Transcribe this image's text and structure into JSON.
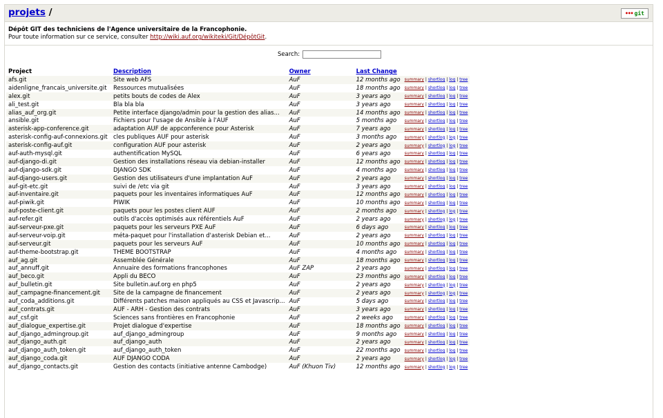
{
  "header": {
    "breadcrumb_link": "projets",
    "breadcrumb_sep": "/",
    "logo_dots": "•••",
    "logo_text": "git"
  },
  "description": {
    "line1": "Dépôt GIT des techniciens de l'Agence universitaire de la Francophonie.",
    "line2_prefix": "Pour toute information sur ce service, consulter ",
    "line2_link": "http://wiki.auf.org/wikiteki/Git/DépôtGit",
    "line2_suffix": "."
  },
  "search": {
    "label": "Search:",
    "value": ""
  },
  "table": {
    "headers": {
      "project": "Project",
      "description": "Description",
      "owner": "Owner",
      "last_change": "Last Change"
    },
    "links": {
      "summary": "summary",
      "shortlog": "shortlog",
      "log": "log",
      "tree": "tree",
      "sep": "|"
    },
    "rows": [
      {
        "project": "afs.git",
        "description": "Site web AFS",
        "owner": "AuF",
        "age": "12 months ago"
      },
      {
        "project": "aidenligne_francais_universite.git",
        "description": "Ressources mutualisées",
        "owner": "AuF",
        "age": "18 months ago"
      },
      {
        "project": "alex.git",
        "description": "petits bouts de codes de Alex",
        "owner": "AuF",
        "age": "3 years ago"
      },
      {
        "project": "ali_test.git",
        "description": "Bla bla bla",
        "owner": "AuF",
        "age": "3 years ago"
      },
      {
        "project": "alias_auf_org.git",
        "description": "Petite interface django/admin pour la gestion des alias...",
        "owner": "AuF",
        "age": "14 months ago"
      },
      {
        "project": "ansible.git",
        "description": "Fichiers pour l'usage de Ansible à l'AUF",
        "owner": "AuF",
        "age": "5 months ago"
      },
      {
        "project": "asterisk-app-conference.git",
        "description": "adaptation AUF de appconference pour Asterisk",
        "owner": "AuF",
        "age": "7 years ago"
      },
      {
        "project": "asterisk-config-auf-connexions.git",
        "description": "cles publiques AUF pour asterisk",
        "owner": "AuF",
        "age": "3 months ago"
      },
      {
        "project": "asterisk-config-auf.git",
        "description": "configuration AUF pour asterisk",
        "owner": "AuF",
        "age": "2 years ago"
      },
      {
        "project": "auf-auth-mysql.git",
        "description": "authentification MySQL",
        "owner": "AuF",
        "age": "6 years ago"
      },
      {
        "project": "auf-django-di.git",
        "description": "Gestion des installations réseau via debian-installer",
        "owner": "AuF",
        "age": "12 months ago"
      },
      {
        "project": "auf-django-sdk.git",
        "description": "DJANGO SDK",
        "owner": "AuF",
        "age": "4 months ago"
      },
      {
        "project": "auf-django-users.git",
        "description": "Gestion des utilisateurs d'une implantation AuF",
        "owner": "AuF",
        "age": "2 years ago"
      },
      {
        "project": "auf-git-etc.git",
        "description": "suivi de /etc via git",
        "owner": "AuF",
        "age": "3 years ago"
      },
      {
        "project": "auf-inventaire.git",
        "description": "paquets pour les inventaires informatiques AuF",
        "owner": "AuF",
        "age": "12 months ago"
      },
      {
        "project": "auf-piwik.git",
        "description": "PIWIK",
        "owner": "AuF",
        "age": "10 months ago"
      },
      {
        "project": "auf-poste-client.git",
        "description": "paquets pour les postes client AUF",
        "owner": "AuF",
        "age": "2 months ago"
      },
      {
        "project": "auf-refer.git",
        "description": "outils d'accès optimisés aux référentiels AuF",
        "owner": "AuF",
        "age": "2 years ago"
      },
      {
        "project": "auf-serveur-pxe.git",
        "description": "paquets pour les serveurs PXE AuF",
        "owner": "AuF",
        "age": "6 days ago"
      },
      {
        "project": "auf-serveur-voip.git",
        "description": "méta-paquet pour l'installation d'asterisk Debian et...",
        "owner": "AuF",
        "age": "2 years ago"
      },
      {
        "project": "auf-serveur.git",
        "description": "paquets pour les serveurs AuF",
        "owner": "AuF",
        "age": "10 months ago"
      },
      {
        "project": "auf-theme-bootstrap.git",
        "description": "THEME BOOTSTRAP",
        "owner": "AuF",
        "age": "4 months ago"
      },
      {
        "project": "auf_ag.git",
        "description": "Assemblée Générale",
        "owner": "AuF",
        "age": "18 months ago"
      },
      {
        "project": "auf_annuff.git",
        "description": "Annuaire des formations francophones",
        "owner": "AuF ZAP",
        "age": "2 years ago"
      },
      {
        "project": "auf_beco.git",
        "description": "Appli du BECO",
        "owner": "AuF",
        "age": "23 months ago"
      },
      {
        "project": "auf_bulletin.git",
        "description": "Site bulletin.auf.org en php5",
        "owner": "AuF",
        "age": "2 years ago"
      },
      {
        "project": "auf_campagne-financement.git",
        "description": "Site de la campagne de financement",
        "owner": "AuF",
        "age": "2 years ago"
      },
      {
        "project": "auf_coda_additions.git",
        "description": "Différents patches maison appliqués au CSS et Javascrip...",
        "owner": "AuF",
        "age": "5 days ago"
      },
      {
        "project": "auf_contrats.git",
        "description": "AUF - ARH - Gestion des contrats",
        "owner": "AuF",
        "age": "3 years ago"
      },
      {
        "project": "auf_csf.git",
        "description": "Sciences sans frontières en Francophonie",
        "owner": "AuF",
        "age": "2 weeks ago"
      },
      {
        "project": "auf_dialogue_expertise.git",
        "description": "Projet dialogue d'expertise",
        "owner": "AuF",
        "age": "18 months ago"
      },
      {
        "project": "auf_django_admingroup.git",
        "description": "auf_django_admingroup",
        "owner": "AuF",
        "age": "9 months ago"
      },
      {
        "project": "auf_django_auth.git",
        "description": "auf_django_auth",
        "owner": "AuF",
        "age": "2 years ago"
      },
      {
        "project": "auf_django_auth_token.git",
        "description": "auf_django_auth_token",
        "owner": "AuF",
        "age": "22 months ago"
      },
      {
        "project": "auf_django_coda.git",
        "description": "AUF DJANGO CODA",
        "owner": "AuF",
        "age": "2 years ago"
      },
      {
        "project": "auf_django_contacts.git",
        "description": "Gestion des contacts (initiative antenne Cambodge)",
        "owner": "AuF (Khuon Tiv)",
        "age": "12 months ago"
      }
    ]
  }
}
